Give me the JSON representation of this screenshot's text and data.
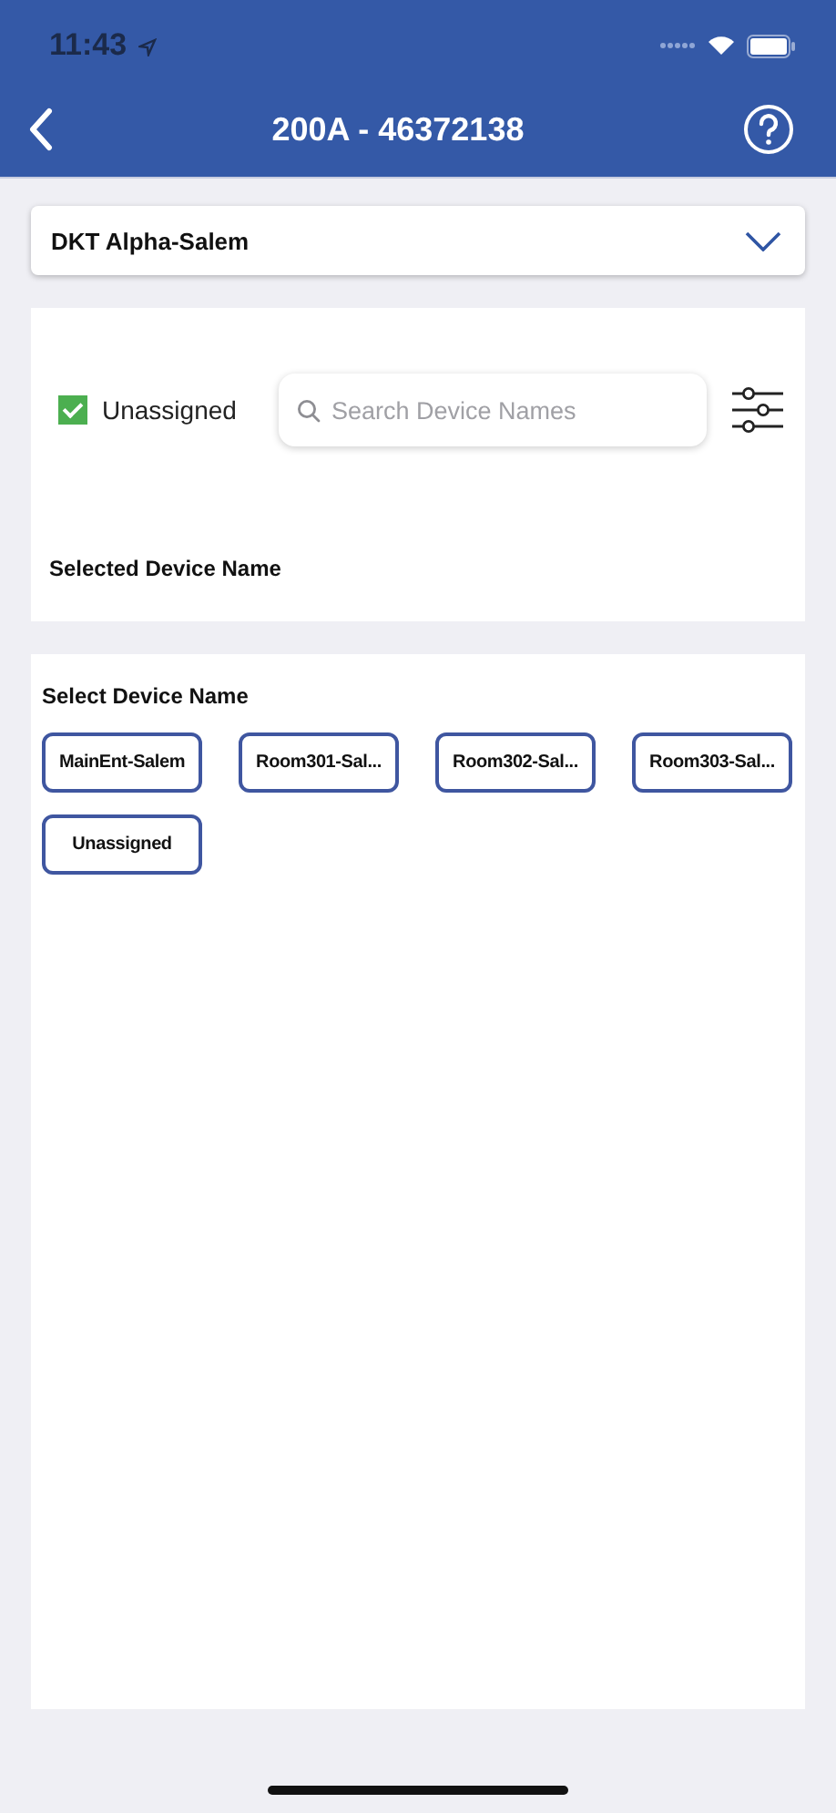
{
  "status_bar": {
    "time": "11:43"
  },
  "nav": {
    "title": "200A - 46372138"
  },
  "site_dropdown": {
    "value": "DKT Alpha-Salem"
  },
  "filter": {
    "unassigned": {
      "label": "Unassigned",
      "checked": true
    },
    "search": {
      "placeholder": "Search Device Names"
    }
  },
  "selected_section": {
    "title": "Selected Device Name"
  },
  "select_section": {
    "title": "Select Device Name",
    "devices": [
      {
        "label": "MainEnt-Salem"
      },
      {
        "label": "Room301-Sal..."
      },
      {
        "label": "Room302-Sal..."
      },
      {
        "label": "Room303-Sal..."
      },
      {
        "label": "Unassigned"
      }
    ]
  }
}
